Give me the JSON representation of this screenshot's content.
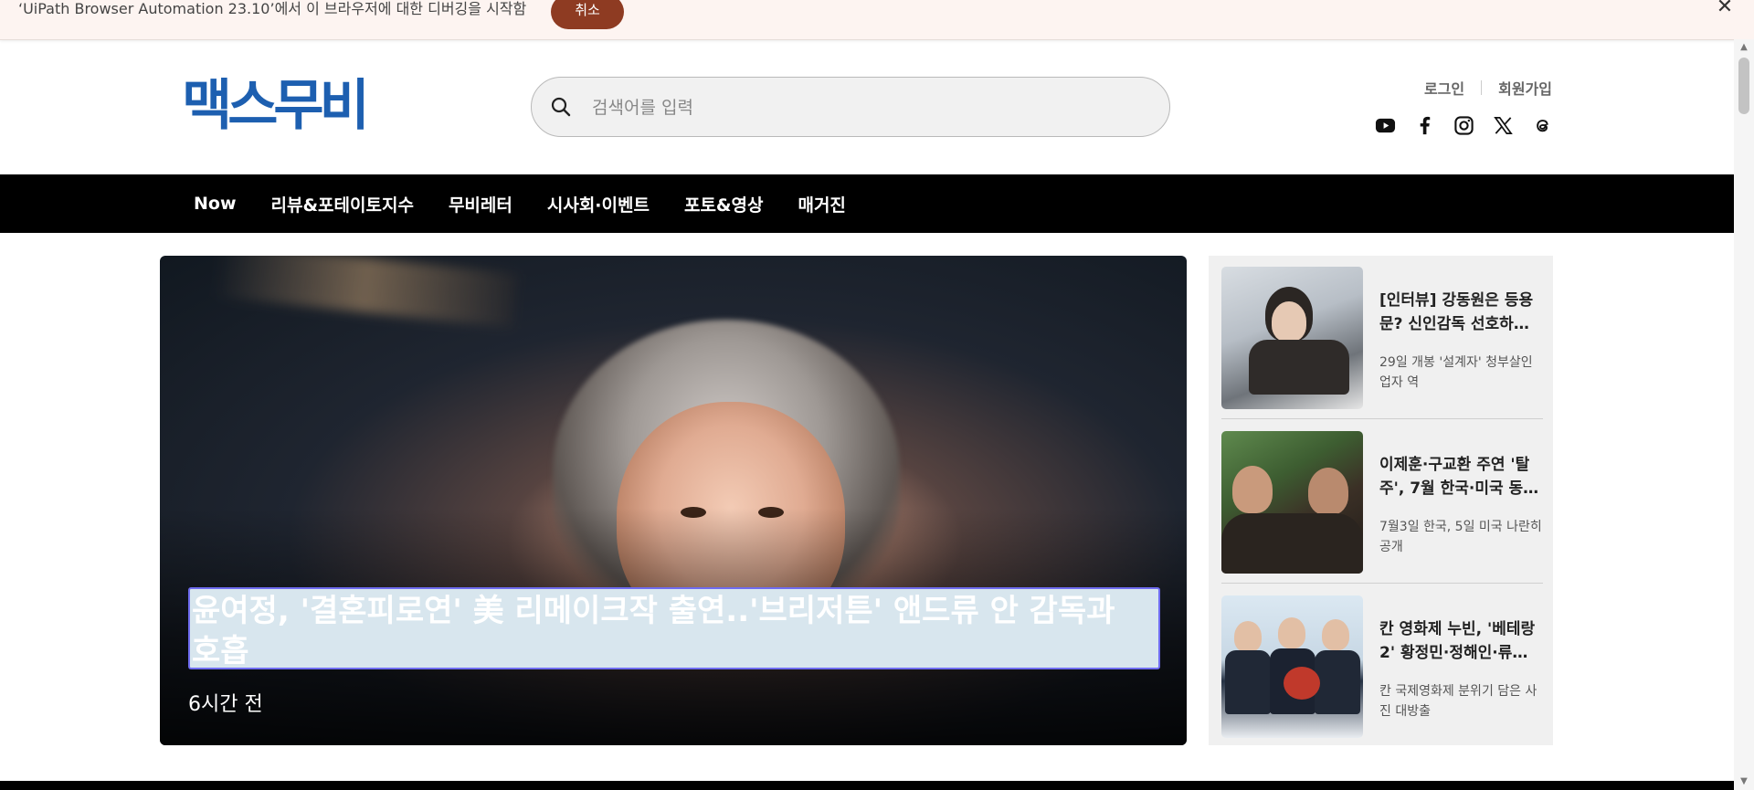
{
  "infobar": {
    "message": "‘UiPath Browser Automation 23.10’에서 이 브라우저에 대한 디버깅을 시작함",
    "cancel_label": "취소",
    "close_label": "✕"
  },
  "header": {
    "logo_text": "맥스무비",
    "search_placeholder": "검색어를 입력",
    "login_label": "로그인",
    "signup_label": "회원가입",
    "socials": [
      "youtube-icon",
      "facebook-icon",
      "instagram-icon",
      "x-icon",
      "threads-icon"
    ]
  },
  "nav": {
    "items": [
      "Now",
      "리뷰&포테이토지수",
      "무비레터",
      "시사회·이벤트",
      "포토&영상",
      "매거진"
    ]
  },
  "hero": {
    "title": "윤여정, '결혼피로연' 美 리메이크작 출연..'브리저튼' 앤드류 안 감독과 호흡",
    "time": "6시간 전"
  },
  "sidebar": {
    "cards": [
      {
        "title": "[인터뷰] 강동원은 등용문? 신인감독 선호하…",
        "sub": "29일 개봉 '설계자' 청부살인업자 역"
      },
      {
        "title": "이제훈·구교환 주연 '탈주', 7월 한국·미국 동…",
        "sub": "7월3일 한국, 5일 미국 나란히 공개"
      },
      {
        "title": "칸 영화제 누빈, '베테랑2' 황정민·정해인·류…",
        "sub": "칸 국제영화제 분위기 담은 사진 대방출"
      }
    ]
  },
  "colors": {
    "logo": "#1d5fb0",
    "nav_bg": "#000000",
    "cancel_button": "#8e3b22",
    "selection_highlight": "#d8e6ee"
  }
}
